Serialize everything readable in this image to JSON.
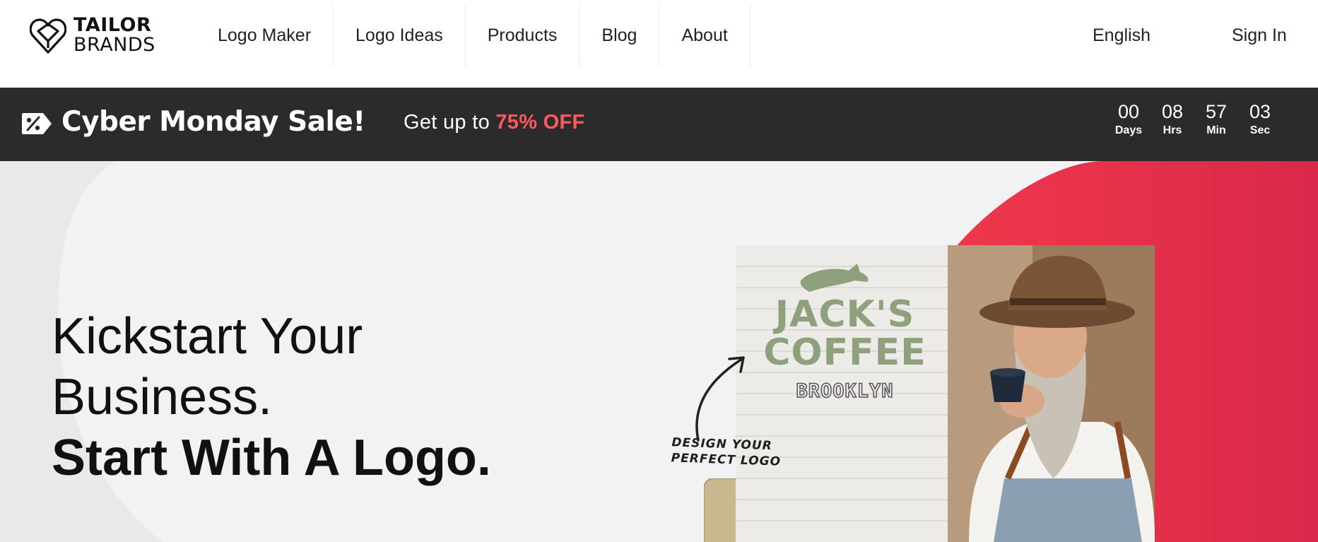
{
  "brand": {
    "line1": "TAILOR",
    "line2": "BRANDS",
    "icon": "heart-shield-icon"
  },
  "nav": {
    "items": [
      {
        "label": "Logo Maker"
      },
      {
        "label": "Logo Ideas"
      },
      {
        "label": "Products"
      },
      {
        "label": "Blog"
      },
      {
        "label": "About"
      }
    ],
    "language": "English",
    "sign_in": "Sign In"
  },
  "promo": {
    "icon": "sale-tag-icon",
    "title": "Cyber Monday Sale!",
    "offer_prefix": "Get up to ",
    "offer_highlight": "75% OFF",
    "highlight_color": "#ff5a5f",
    "countdown": [
      {
        "value": "00",
        "label": "Days"
      },
      {
        "value": "08",
        "label": "Hrs"
      },
      {
        "value": "57",
        "label": "Min"
      },
      {
        "value": "03",
        "label": "Sec"
      }
    ]
  },
  "hero": {
    "headline_line1": "Kickstart Your",
    "headline_line2": "Business.",
    "headline_line3": "Start With A Logo.",
    "accent_color": "#e8334a",
    "image": {
      "sign_line1": "JACK'S",
      "sign_line2": "COFFEE",
      "sign_line3": "BROOKLYN",
      "callout_line1": "DESIGN YOUR",
      "callout_line2": "PERFECT LOGO",
      "sign_color": "#8fa07c"
    }
  }
}
